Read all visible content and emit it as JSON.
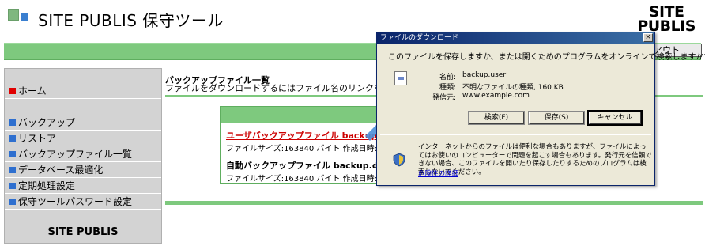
{
  "header": {
    "title": "SITE PUBLIS 保守ツール",
    "brand_line1": "SITE",
    "brand_line2": "PUBLIS",
    "logout_label": "アウト"
  },
  "sidebar": {
    "items": [
      {
        "label": "ホーム",
        "bullet_color": "#e00000"
      },
      {
        "label": "バックアップ",
        "bullet_color": "#2e6fcf"
      },
      {
        "label": "リストア",
        "bullet_color": "#2e6fcf"
      },
      {
        "label": "バックアップファイル一覧",
        "bullet_color": "#2e6fcf"
      },
      {
        "label": "データベース最適化",
        "bullet_color": "#2e6fcf"
      },
      {
        "label": "定期処理設定",
        "bullet_color": "#2e6fcf"
      },
      {
        "label": "保守ツールパスワード設定",
        "bullet_color": "#2e6fcf"
      }
    ],
    "brand": "SITE PUBLIS"
  },
  "main": {
    "title": "バックアップファイル一覧",
    "description": "ファイルをダウンロードするにはファイル名のリンクを右クリックし",
    "files": [
      {
        "name": "ユーザバックアップファイル backup.user",
        "meta": "ファイルサイズ:163840 バイト 作成日時:2010"
      },
      {
        "name": "自動バックアップファイル backup.daily",
        "meta": "ファイルサイズ:163840 バイト 作成日時:2010"
      }
    ]
  },
  "dialog": {
    "title": "ファイルのダウンロード",
    "close_label": "×",
    "question": "このファイルを保存しますか、または開くためのプログラムをオンラインで検索しますか?",
    "fields": [
      {
        "label": "名前:",
        "value": "backup.user"
      },
      {
        "label": "種類:",
        "value": "不明なファイルの種類, 160 KB"
      },
      {
        "label": "発信元:",
        "value": "www.example.com"
      }
    ],
    "buttons": {
      "search": "検索(F)",
      "save": "保存(S)",
      "cancel": "キャンセル"
    },
    "warning": "インターネットからのファイルは便利な場合もありますが、ファイルによってはお使いのコンピューターで問題を起こす場合もあります。発行元を信頼できない場合、このファイルを開いたり保存したりするためのプログラムは検索しないでください。",
    "risk_link": "危険性の詳細"
  },
  "colors": {
    "accent_green": "#7ec97e",
    "link_red": "#cc0000",
    "sidebar_bg": "#d3d3d3",
    "arrow_blue": "#4a90d9"
  }
}
